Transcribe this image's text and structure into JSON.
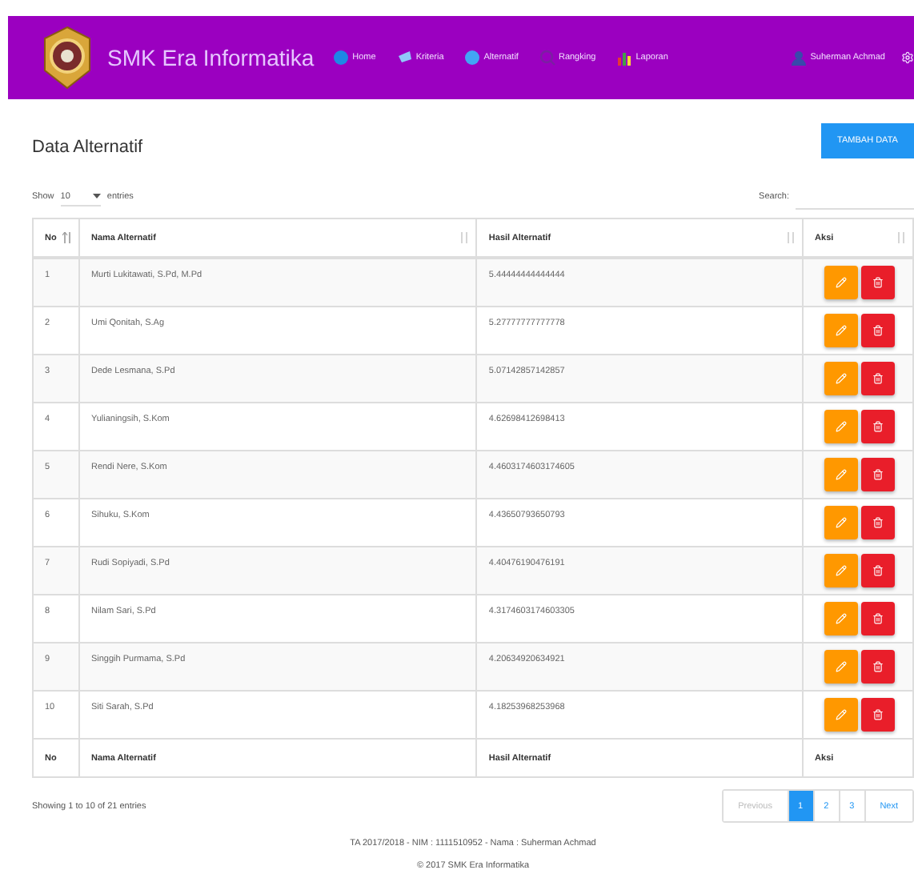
{
  "navbar": {
    "brand": "SMK Era Informatika",
    "items": [
      {
        "label": "Home"
      },
      {
        "label": "Kriteria"
      },
      {
        "label": "Alternatif"
      },
      {
        "label": "Rangking"
      },
      {
        "label": "Laporan"
      }
    ],
    "user": "Suherman Achmad"
  },
  "page_title": "Data Alternatif",
  "add_button": "TAMBAH DATA",
  "length": {
    "show": "Show",
    "value": "10",
    "entries": "entries"
  },
  "search": {
    "label": "Search:"
  },
  "table": {
    "columns": [
      {
        "label": "No",
        "sorted": true
      },
      {
        "label": "Nama Alternatif",
        "sorted": false
      },
      {
        "label": "Hasil Alternatif",
        "sorted": false
      },
      {
        "label": "Aksi",
        "sorted": false
      }
    ],
    "rows": [
      {
        "no": "1",
        "nama": "Murti Lukitawati, S.Pd, M.Pd",
        "hasil": "5.44444444444444"
      },
      {
        "no": "2",
        "nama": "Umi Qonitah, S.Ag",
        "hasil": "5.27777777777778"
      },
      {
        "no": "3",
        "nama": "Dede Lesmana, S.Pd",
        "hasil": "5.07142857142857"
      },
      {
        "no": "4",
        "nama": "Yulianingsih, S.Kom",
        "hasil": "4.62698412698413"
      },
      {
        "no": "5",
        "nama": "Rendi Nere, S.Kom",
        "hasil": "4.4603174603174605"
      },
      {
        "no": "6",
        "nama": "Sihuku, S.Kom",
        "hasil": "4.43650793650793"
      },
      {
        "no": "7",
        "nama": "Rudi Sopiyadi, S.Pd",
        "hasil": "4.40476190476191"
      },
      {
        "no": "8",
        "nama": "Nilam Sari, S.Pd",
        "hasil": "4.3174603174603305"
      },
      {
        "no": "9",
        "nama": "Singgih Purmama, S.Pd",
        "hasil": "4.20634920634921"
      },
      {
        "no": "10",
        "nama": "Siti Sarah, S.Pd",
        "hasil": "4.18253968253968"
      }
    ],
    "footer": [
      "No",
      "Nama Alternatif",
      "Hasil Alternatif",
      "Aksi"
    ]
  },
  "info": "Showing 1 to 10 of 21 entries",
  "pagination": [
    {
      "label": "Previous",
      "kind": "nav",
      "disabled": true,
      "selected": false
    },
    {
      "label": "1",
      "kind": "page",
      "disabled": false,
      "selected": true
    },
    {
      "label": "2",
      "kind": "page",
      "disabled": false,
      "selected": false
    },
    {
      "label": "3",
      "kind": "page",
      "disabled": false,
      "selected": false
    },
    {
      "label": "Next",
      "kind": "nav",
      "disabled": false,
      "selected": false
    }
  ],
  "footer_lines": [
    "TA 2017/2018 - NIM : 1111510952 - Nama : Suherman Achmad",
    "© 2017 SMK Era Informatika"
  ]
}
